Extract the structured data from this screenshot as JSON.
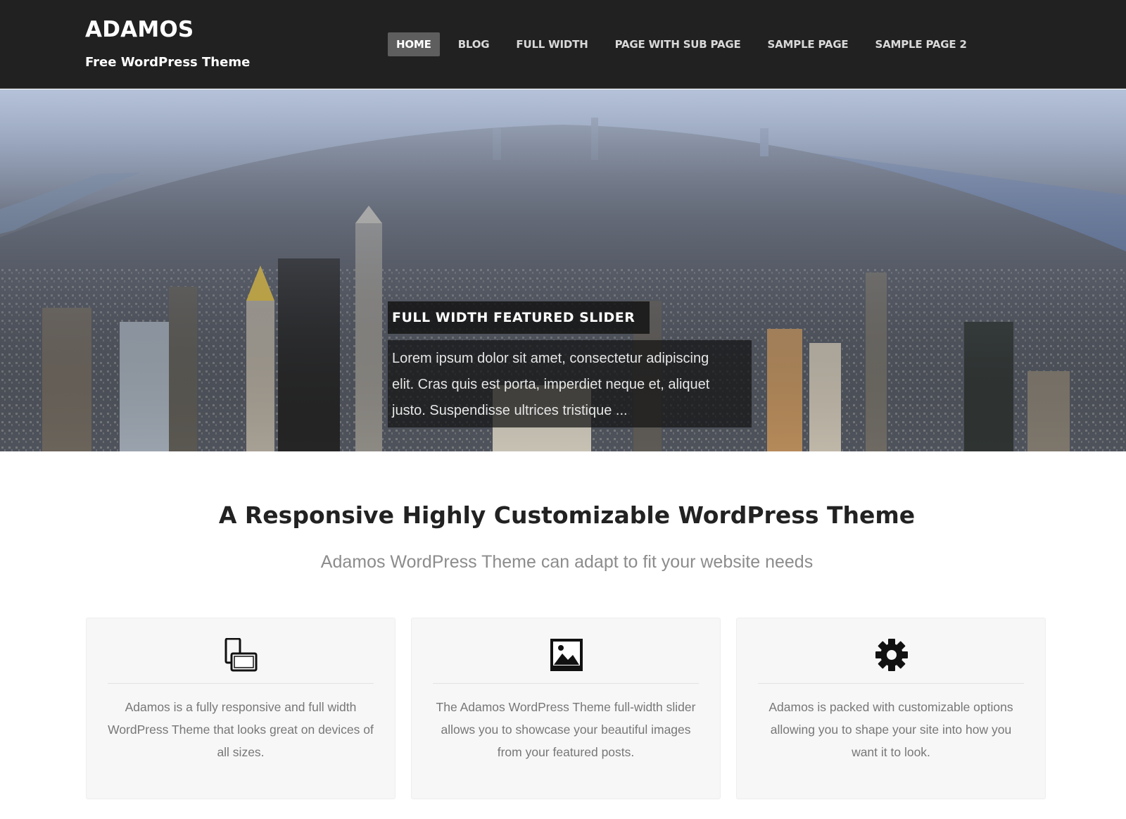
{
  "site": {
    "title": "ADAMOS",
    "tagline": "Free WordPress Theme"
  },
  "nav": {
    "items": [
      {
        "label": "HOME",
        "active": true
      },
      {
        "label": "BLOG"
      },
      {
        "label": "FULL WIDTH"
      },
      {
        "label": "PAGE WITH SUB PAGE"
      },
      {
        "label": "SAMPLE PAGE"
      },
      {
        "label": "SAMPLE PAGE 2"
      }
    ]
  },
  "slider": {
    "title": "FULL WIDTH FEATURED SLIDER",
    "excerpt_lines": [
      "Lorem ipsum dolor sit amet, consectetur adipiscing",
      "elit. Cras quis est porta, imperdiet neque et, aliquet",
      "justo. Suspendisse ultrices tristique ..."
    ]
  },
  "intro": {
    "title": "A Responsive Highly Customizable WordPress Theme",
    "subtitle": "Adamos WordPress Theme can adapt to fit your website needs"
  },
  "features": [
    {
      "icon": "devices-icon",
      "lines": [
        "Adamos is a fully responsive and full width",
        "WordPress Theme that looks great on devices of",
        "all sizes."
      ]
    },
    {
      "icon": "image-icon",
      "lines": [
        "The Adamos WordPress Theme full-width slider",
        "allows you to showcase your beautiful images",
        "from your featured posts."
      ]
    },
    {
      "icon": "gear-icon",
      "lines": [
        "Adamos is packed with customizable options",
        "allowing you to shape your site into how you",
        "want it to look."
      ]
    }
  ],
  "colors": {
    "header_bg": "#212121",
    "nav_active_bg": "#5e5e5e",
    "feature_bg": "#f7f7f7"
  }
}
